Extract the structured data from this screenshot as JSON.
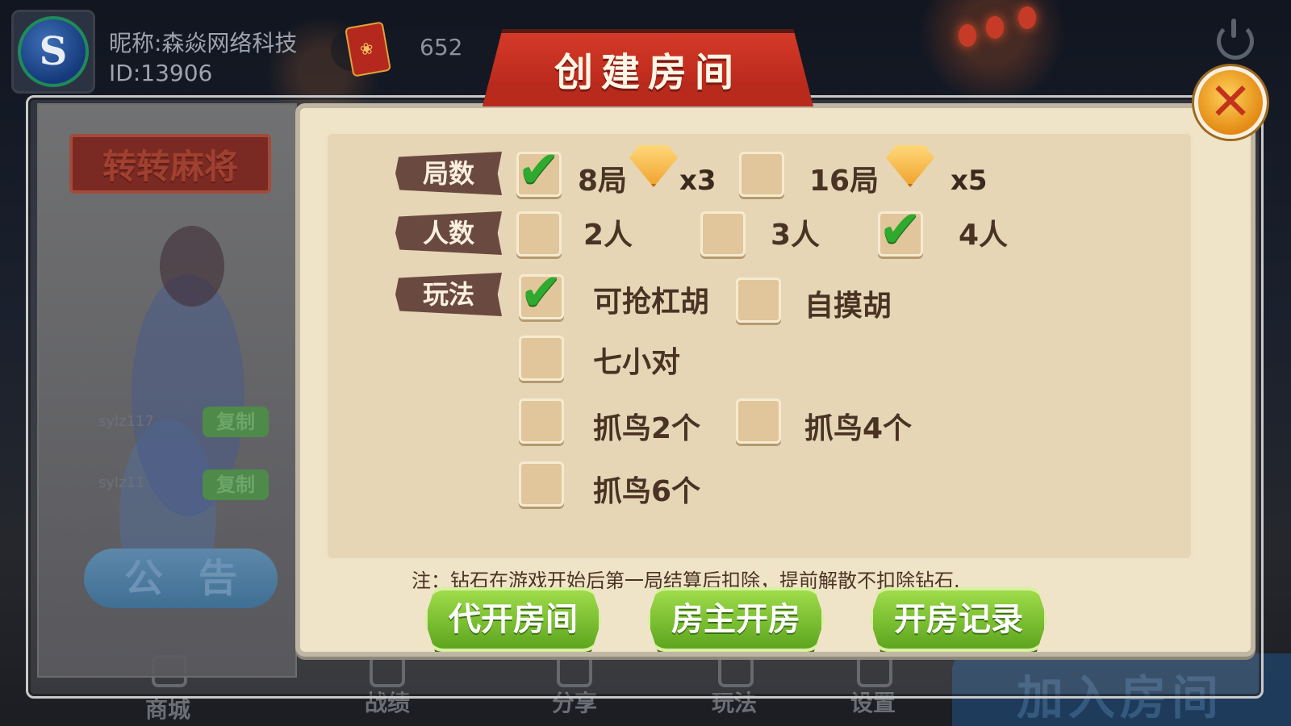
{
  "user": {
    "nickname": "昵称:森焱网络科技",
    "id": "ID:13906",
    "avatar_letter": "S",
    "diamonds": "652"
  },
  "dialog": {
    "title": "创建房间",
    "close_icon": "✕"
  },
  "game": {
    "name": "转转麻将",
    "codes": [
      {
        "code": "sylz117",
        "copy_label": "复制"
      },
      {
        "code": "sylz11",
        "copy_label": "复制"
      }
    ],
    "notice_label": "公告"
  },
  "options": {
    "rounds": {
      "label": "局数",
      "items": [
        {
          "label": "8局",
          "cost": "x3",
          "checked": true
        },
        {
          "label": "16局",
          "cost": "x5",
          "checked": false
        }
      ]
    },
    "players": {
      "label": "人数",
      "items": [
        {
          "label": "2人",
          "checked": false
        },
        {
          "label": "3人",
          "checked": false
        },
        {
          "label": "4人",
          "checked": true
        }
      ]
    },
    "rules": {
      "label": "玩法",
      "items": [
        {
          "label": "可抢杠胡",
          "checked": true
        },
        {
          "label": "自摸胡",
          "checked": false
        },
        {
          "label": "七小对",
          "checked": false
        },
        {
          "label": "抓鸟2个",
          "checked": false
        },
        {
          "label": "抓鸟4个",
          "checked": false
        },
        {
          "label": "抓鸟6个",
          "checked": false
        }
      ]
    },
    "check_glyph": "✔"
  },
  "note": "注：钻石在游戏开始后第一局结算后扣除，提前解散不扣除钻石.",
  "buttons": {
    "proxy_open": "代开房间",
    "host_open": "房主开房",
    "records": "开房记录"
  },
  "bottom_nav": {
    "shop": "商城",
    "records": "战绩",
    "share": "分享",
    "rules": "玩法",
    "settings": "设置",
    "join_room": "加入房间"
  },
  "colors": {
    "panel_bg": "#f0e4c8",
    "title_red": "#c22d1f",
    "check_green": "#2fa92e",
    "button_green": "#6fb82a"
  }
}
